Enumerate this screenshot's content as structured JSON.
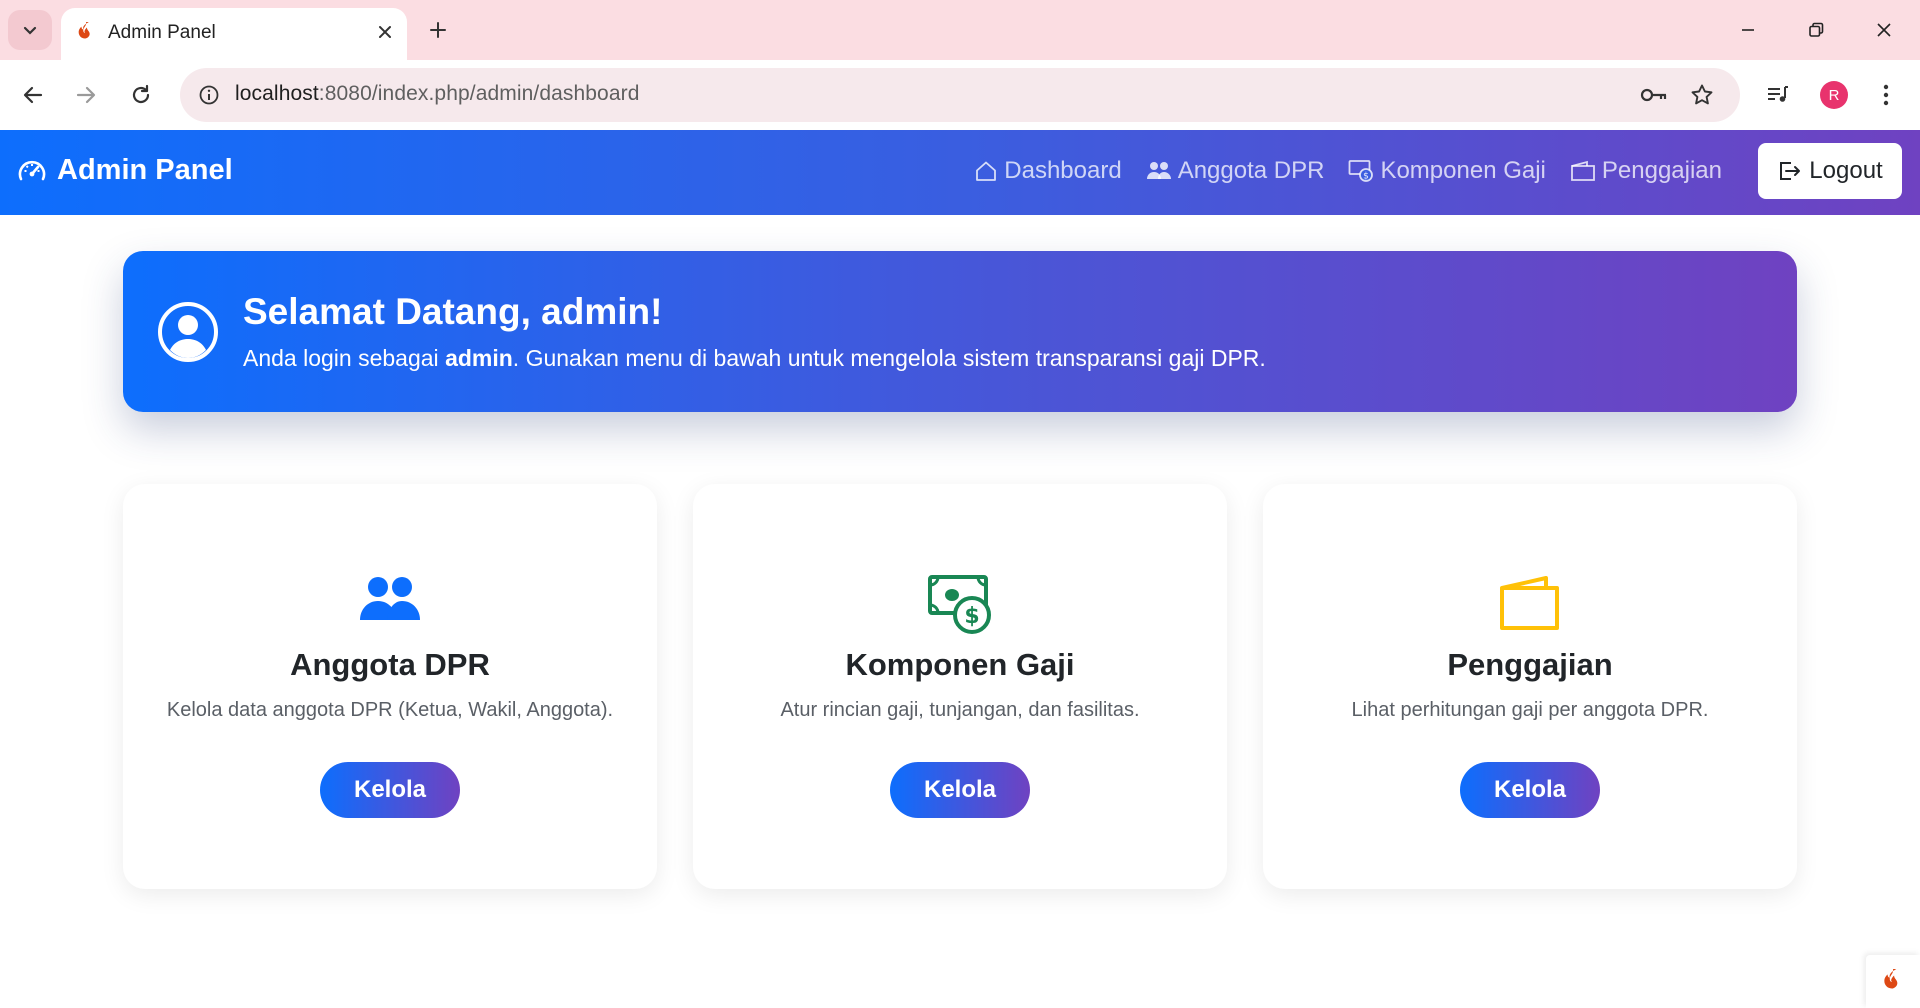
{
  "browser": {
    "tab_title": "Admin Panel",
    "url_host": "localhost",
    "url_path": ":8080/index.php/admin/dashboard",
    "profile_initial": "R"
  },
  "navbar": {
    "brand": "Admin Panel",
    "links": [
      {
        "label": "Dashboard",
        "icon": "house-icon"
      },
      {
        "label": "Anggota DPR",
        "icon": "people-icon"
      },
      {
        "label": "Komponen Gaji",
        "icon": "cash-coin-icon"
      },
      {
        "label": "Penggajian",
        "icon": "wallet-icon"
      }
    ],
    "logout_label": "Logout"
  },
  "welcome": {
    "title": "Selamat Datang, admin!",
    "text_prefix": "Anda login sebagai ",
    "role": "admin",
    "text_suffix": ". Gunakan menu di bawah untuk mengelola sistem transparansi gaji DPR."
  },
  "cards": [
    {
      "title": "Anggota DPR",
      "desc": "Kelola data anggota DPR (Ketua, Wakil, Anggota).",
      "button": "Kelola",
      "icon": "people-icon",
      "icon_color": "#0d6efd"
    },
    {
      "title": "Komponen Gaji",
      "desc": "Atur rincian gaji, tunjangan, dan fasilitas.",
      "button": "Kelola",
      "icon": "cash-coin-icon",
      "icon_color": "#198754"
    },
    {
      "title": "Penggajian",
      "desc": "Lihat perhitungan gaji per anggota DPR.",
      "button": "Kelola",
      "icon": "wallet-icon",
      "icon_color": "#ffc107"
    }
  ],
  "colors": {
    "primary": "#0d6efd",
    "purple": "#6f42c1",
    "success": "#198754",
    "warning": "#ffc107"
  }
}
